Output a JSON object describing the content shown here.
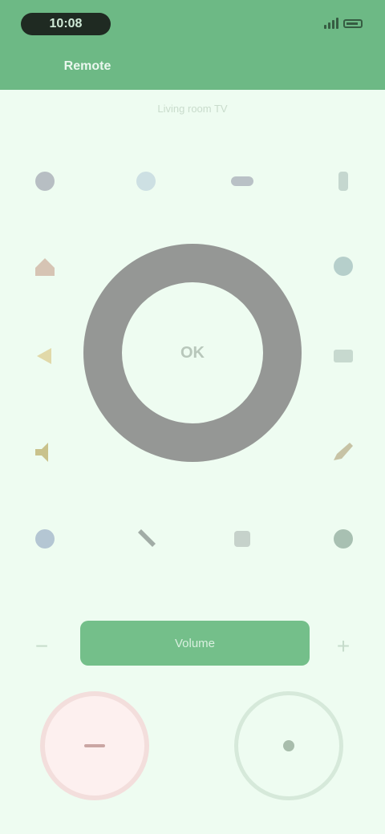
{
  "status_bar": {
    "time": "10:08"
  },
  "header": {
    "title": "Remote"
  },
  "subtitle": "Living room TV",
  "grid": [
    {
      "name": "power-icon",
      "color": "#8b8b9c"
    },
    {
      "name": "input-icon",
      "color": "#cde0e3"
    },
    {
      "name": "menu-icon",
      "color": "#b9c1c6"
    },
    {
      "name": "info-icon",
      "color": "#c5d7cf"
    },
    {
      "name": "home-icon",
      "color": "#d6c4b4"
    },
    {
      "name": "settings-icon",
      "color": "#b6cfcb"
    },
    {
      "name": "back-icon",
      "color": "#e1d9a9"
    },
    {
      "name": "guide-icon",
      "color": "#c7d9cf"
    },
    {
      "name": "mute-icon",
      "color": "#c9c28c"
    },
    {
      "name": "edit-icon",
      "color": "#c7c3a5"
    },
    {
      "name": "voice-icon",
      "color": "#b4c6d3"
    },
    {
      "name": "tools-icon",
      "color": "#a1aca6"
    },
    {
      "name": "apps-icon",
      "color": "#c6d2cb"
    },
    {
      "name": "keypad-icon",
      "color": "#a8c0b2"
    }
  ],
  "dial": {
    "center_label": "OK"
  },
  "slider": {
    "label": "Volume",
    "minus": "−",
    "plus": "+"
  }
}
